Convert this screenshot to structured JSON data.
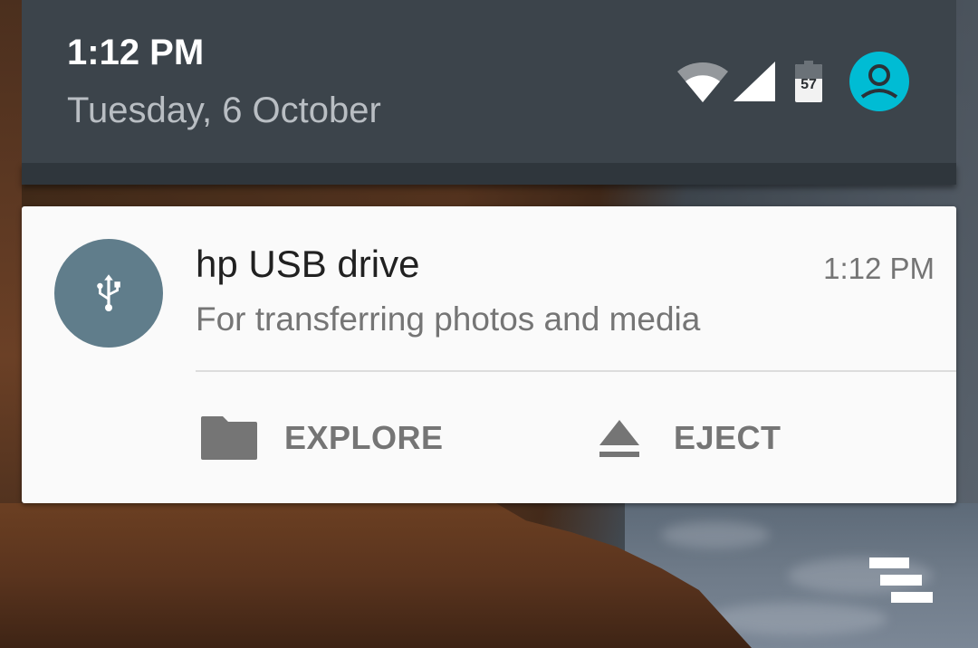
{
  "status_bar": {
    "time": "1:12 PM",
    "date": "Tuesday, 6 October",
    "battery_level": "57",
    "icons": [
      "wifi-icon",
      "cell-signal-icon",
      "battery-icon",
      "user-avatar-icon"
    ]
  },
  "notification": {
    "icon": "usb-icon",
    "title": "hp USB drive",
    "time": "1:12 PM",
    "text": "For transferring photos and media",
    "actions": [
      {
        "icon": "folder-icon",
        "label": "EXPLORE"
      },
      {
        "icon": "eject-icon",
        "label": "EJECT"
      }
    ]
  },
  "clear_all": {
    "icon": "clear-all-icon"
  },
  "colors": {
    "header_bg": "#3c444b",
    "avatar_bg": "#00bcd4",
    "usb_circle_bg": "#607d8b",
    "card_bg": "#fafafa",
    "action_text": "#757575"
  }
}
